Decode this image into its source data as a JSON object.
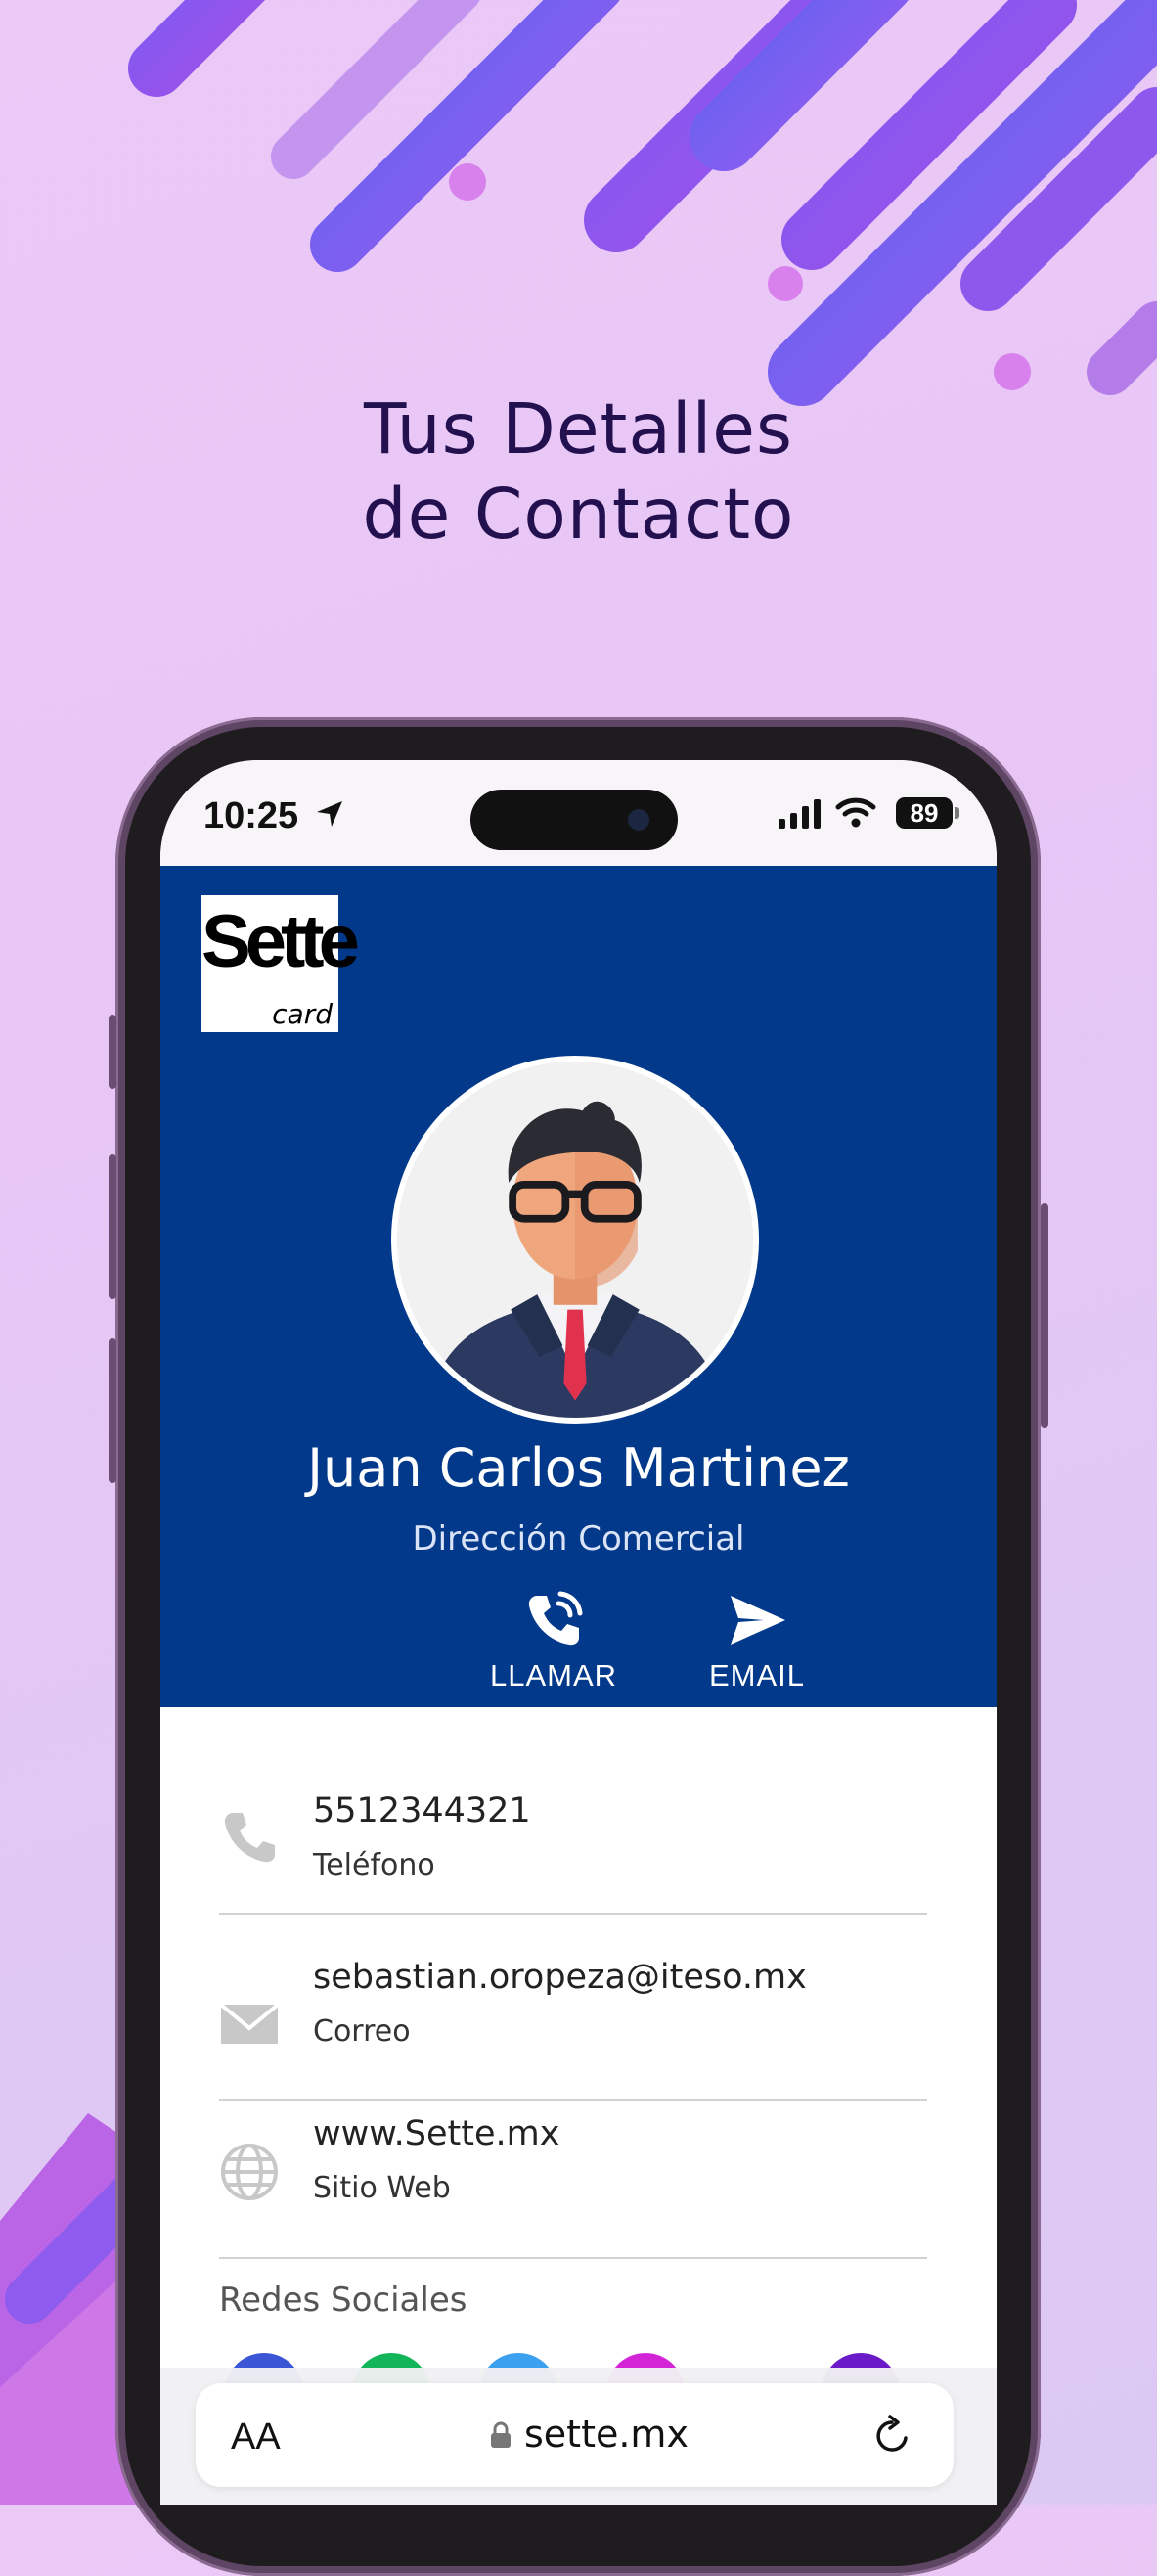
{
  "headline": {
    "line1": "Tus Detalles",
    "line2": "de Contacto"
  },
  "status_bar": {
    "time": "10:25",
    "battery": "89"
  },
  "card": {
    "logo_text": "Sette",
    "logo_sub": "card",
    "name": "Juan Carlos Martinez",
    "role": "Dirección Comercial",
    "actions": [
      {
        "label": "LLAMAR",
        "icon": "phone-icon"
      },
      {
        "label": "EMAIL",
        "icon": "send-icon"
      }
    ],
    "brand_color": "#02398a"
  },
  "contacts": [
    {
      "value": "5512344321",
      "label": "Teléfono",
      "icon": "phone-icon"
    },
    {
      "value": "sebastian.oropeza@iteso.mx",
      "label": "Correo",
      "icon": "mail-icon"
    },
    {
      "value": "www.Sette.mx",
      "label": "Sitio Web",
      "icon": "globe-icon"
    }
  ],
  "social": {
    "title": "Redes Sociales",
    "colors": [
      "#3a55d6",
      "#12b55a",
      "#3aa0ef",
      "#d424d8",
      "#6a1ac7"
    ]
  },
  "browser": {
    "text_size": "AA",
    "url": "sette.mx"
  }
}
